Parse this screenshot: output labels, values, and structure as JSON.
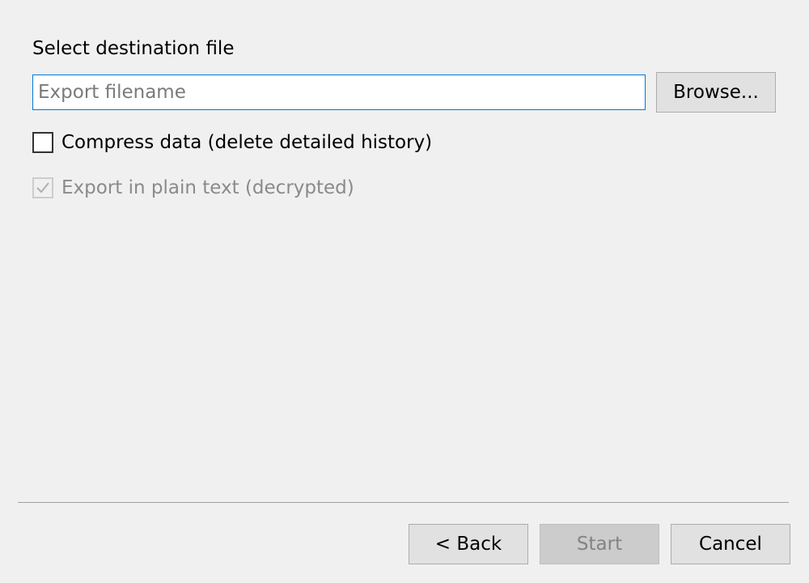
{
  "destination": {
    "label": "Select destination file",
    "filename_value": "",
    "filename_placeholder": "Export filename",
    "browse_label": "Browse..."
  },
  "options": {
    "compress": {
      "label": "Compress data (delete detailed history)",
      "checked": false,
      "enabled": true
    },
    "plain_text": {
      "label": "Export in plain text (decrypted)",
      "checked": true,
      "enabled": false
    }
  },
  "footer": {
    "back_label": "< Back",
    "start_label": "Start",
    "cancel_label": "Cancel"
  },
  "colors": {
    "input_focus_border": "#0078d7",
    "button_face": "#e1e1e1",
    "disabled_text": "#838383"
  },
  "icons": {
    "plain_text_check": "checkmark-icon"
  }
}
